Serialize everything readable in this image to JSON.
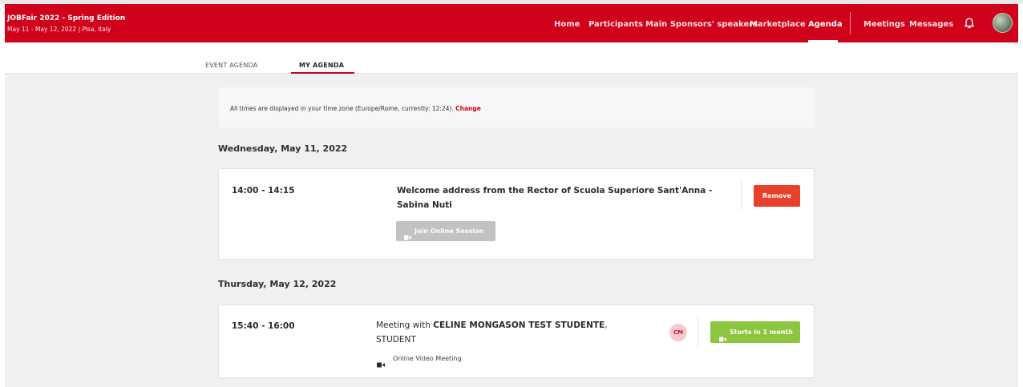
{
  "header": {
    "event_title": "JOBFair 2022 - Spring Edition",
    "event_subtitle": "May 11 - May 12, 2022 | Pisa, Italy",
    "nav": [
      {
        "label": "Home"
      },
      {
        "label": "Participants"
      },
      {
        "label": "Main Sponsors' speakers"
      },
      {
        "label": "Marketplace"
      },
      {
        "label": "Agenda",
        "active": true
      },
      {
        "label": "Meetings"
      },
      {
        "label": "Messages"
      }
    ],
    "icons": {
      "notifications": "bell-icon",
      "profile": "avatar"
    },
    "brand_color": "#d0021b"
  },
  "tabs": [
    {
      "label": "EVENT AGENDA"
    },
    {
      "label": "MY AGENDA",
      "active": true
    }
  ],
  "timezone": {
    "text": "All times are displayed in your time zone (Europe/Rome, currently: 12:24).",
    "change_label": "Change"
  },
  "days": [
    {
      "heading": "Wednesday, May 11, 2022",
      "items": [
        {
          "time": "14:00 - 14:15",
          "title": "Welcome address from the Rector of Scuola Superiore Sant'Anna - Sabina Nuti",
          "join_label": "Join Online Session",
          "action_label": "Remove",
          "action_color": "#e8412b"
        }
      ]
    },
    {
      "heading": "Thursday, May 12, 2022",
      "items": [
        {
          "time": "15:40 - 16:00",
          "title_prefix": "Meeting with",
          "title_name": "CELINE MONGASON TEST STUDENTE",
          "title_suffix": "STUDENT",
          "meeting_type": "Online Video Meeting",
          "initials": "CM",
          "action_label": "Starts in 1 month",
          "action_color": "#8cc63f"
        }
      ]
    }
  ]
}
